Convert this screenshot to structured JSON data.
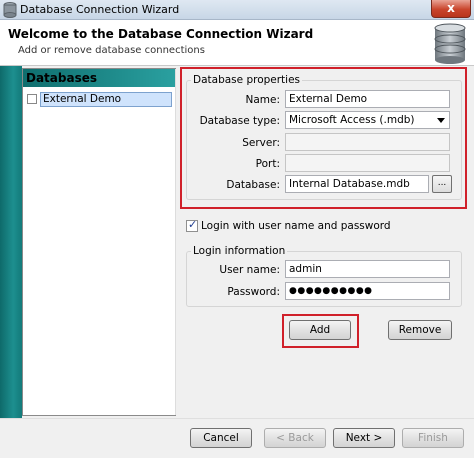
{
  "window": {
    "title": "Database Connection Wizard",
    "close_label": "x"
  },
  "header": {
    "title": "Welcome to the Database Connection Wizard",
    "subtitle": "Add or remove database connections"
  },
  "databases_panel": {
    "title": "Databases",
    "items": [
      {
        "label": "External Demo",
        "checked": false,
        "selected": true
      }
    ]
  },
  "properties": {
    "legend": "Database properties",
    "name_label": "Name:",
    "name_value": "External Demo",
    "type_label": "Database type:",
    "type_value": "Microsoft Access (.mdb)",
    "server_label": "Server:",
    "server_value": "",
    "port_label": "Port:",
    "port_value": "",
    "database_label": "Database:",
    "database_value": "Internal Database.mdb",
    "browse_label": "..."
  },
  "login": {
    "checkbox_label": "Login with user name and password",
    "checked": true,
    "legend": "Login information",
    "username_label": "User name:",
    "username_value": "admin",
    "password_label": "Password:",
    "password_value": "●●●●●●●●●●"
  },
  "actions": {
    "add_label": "Add",
    "remove_label": "Remove"
  },
  "footer": {
    "cancel_label": "Cancel",
    "back_label": "< Back",
    "next_label": "Next >",
    "finish_label": "Finish"
  },
  "colors": {
    "teal": "#1d8f8f",
    "highlight": "#d0202a",
    "selection": "#cfe3fc"
  }
}
